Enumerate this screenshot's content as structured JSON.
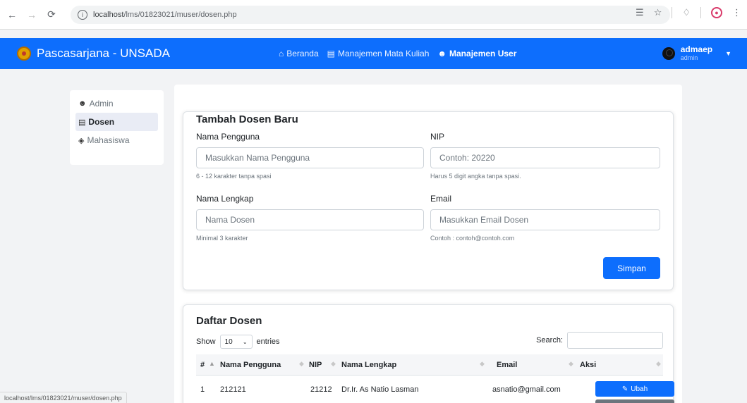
{
  "browser": {
    "url_host": "localhost",
    "url_path": "/lms/01823021/muser/dosen.php"
  },
  "navbar": {
    "brand": "Pascasarjana - UNSADA",
    "links": [
      {
        "label": "Beranda",
        "icon": "home-icon"
      },
      {
        "label": "Manajemen Mata Kuliah",
        "icon": "table-icon"
      },
      {
        "label": "Manajemen User",
        "icon": "users-icon"
      }
    ],
    "user": {
      "name": "admaep",
      "role": "admin"
    }
  },
  "sidebar": {
    "items": [
      {
        "label": "Admin",
        "icon": "users-icon"
      },
      {
        "label": "Dosen",
        "icon": "table-icon"
      },
      {
        "label": "Mahasiswa",
        "icon": "graduation-cap-icon"
      }
    ]
  },
  "form": {
    "title": "Tambah Dosen Baru",
    "username_label": "Nama Pengguna",
    "username_placeholder": "Masukkan Nama Pengguna",
    "username_hint": "6 - 12 karakter tanpa spasi",
    "nip_label": "NIP",
    "nip_placeholder": "Contoh: 20220",
    "nip_hint": "Harus 5 digit angka tanpa spasi.",
    "fullname_label": "Nama Lengkap",
    "fullname_placeholder": "Nama Dosen",
    "fullname_hint": "Minimal 3 karakter",
    "email_label": "Email",
    "email_placeholder": "Masukkan Email Dosen",
    "email_hint": "Contoh : contoh@contoh.com",
    "submit_label": "Simpan"
  },
  "table": {
    "title": "Daftar Dosen",
    "show_label": "Show",
    "page_size": "10",
    "entries_label": "entries",
    "search_label": "Search:",
    "headers": [
      "#",
      "Nama Pengguna",
      "NIP",
      "Nama Lengkap",
      "Email",
      "Aksi"
    ],
    "rows": [
      {
        "no": "1",
        "username": "212121",
        "nip": "21212",
        "fullname": "Dr.Ir. As Natio Lasman",
        "email": "asnatio@gmail.com"
      }
    ],
    "edit_label": "Ubah"
  },
  "statusbar": {
    "text": "localhost/lms/01823021/muser/dosen.php"
  }
}
